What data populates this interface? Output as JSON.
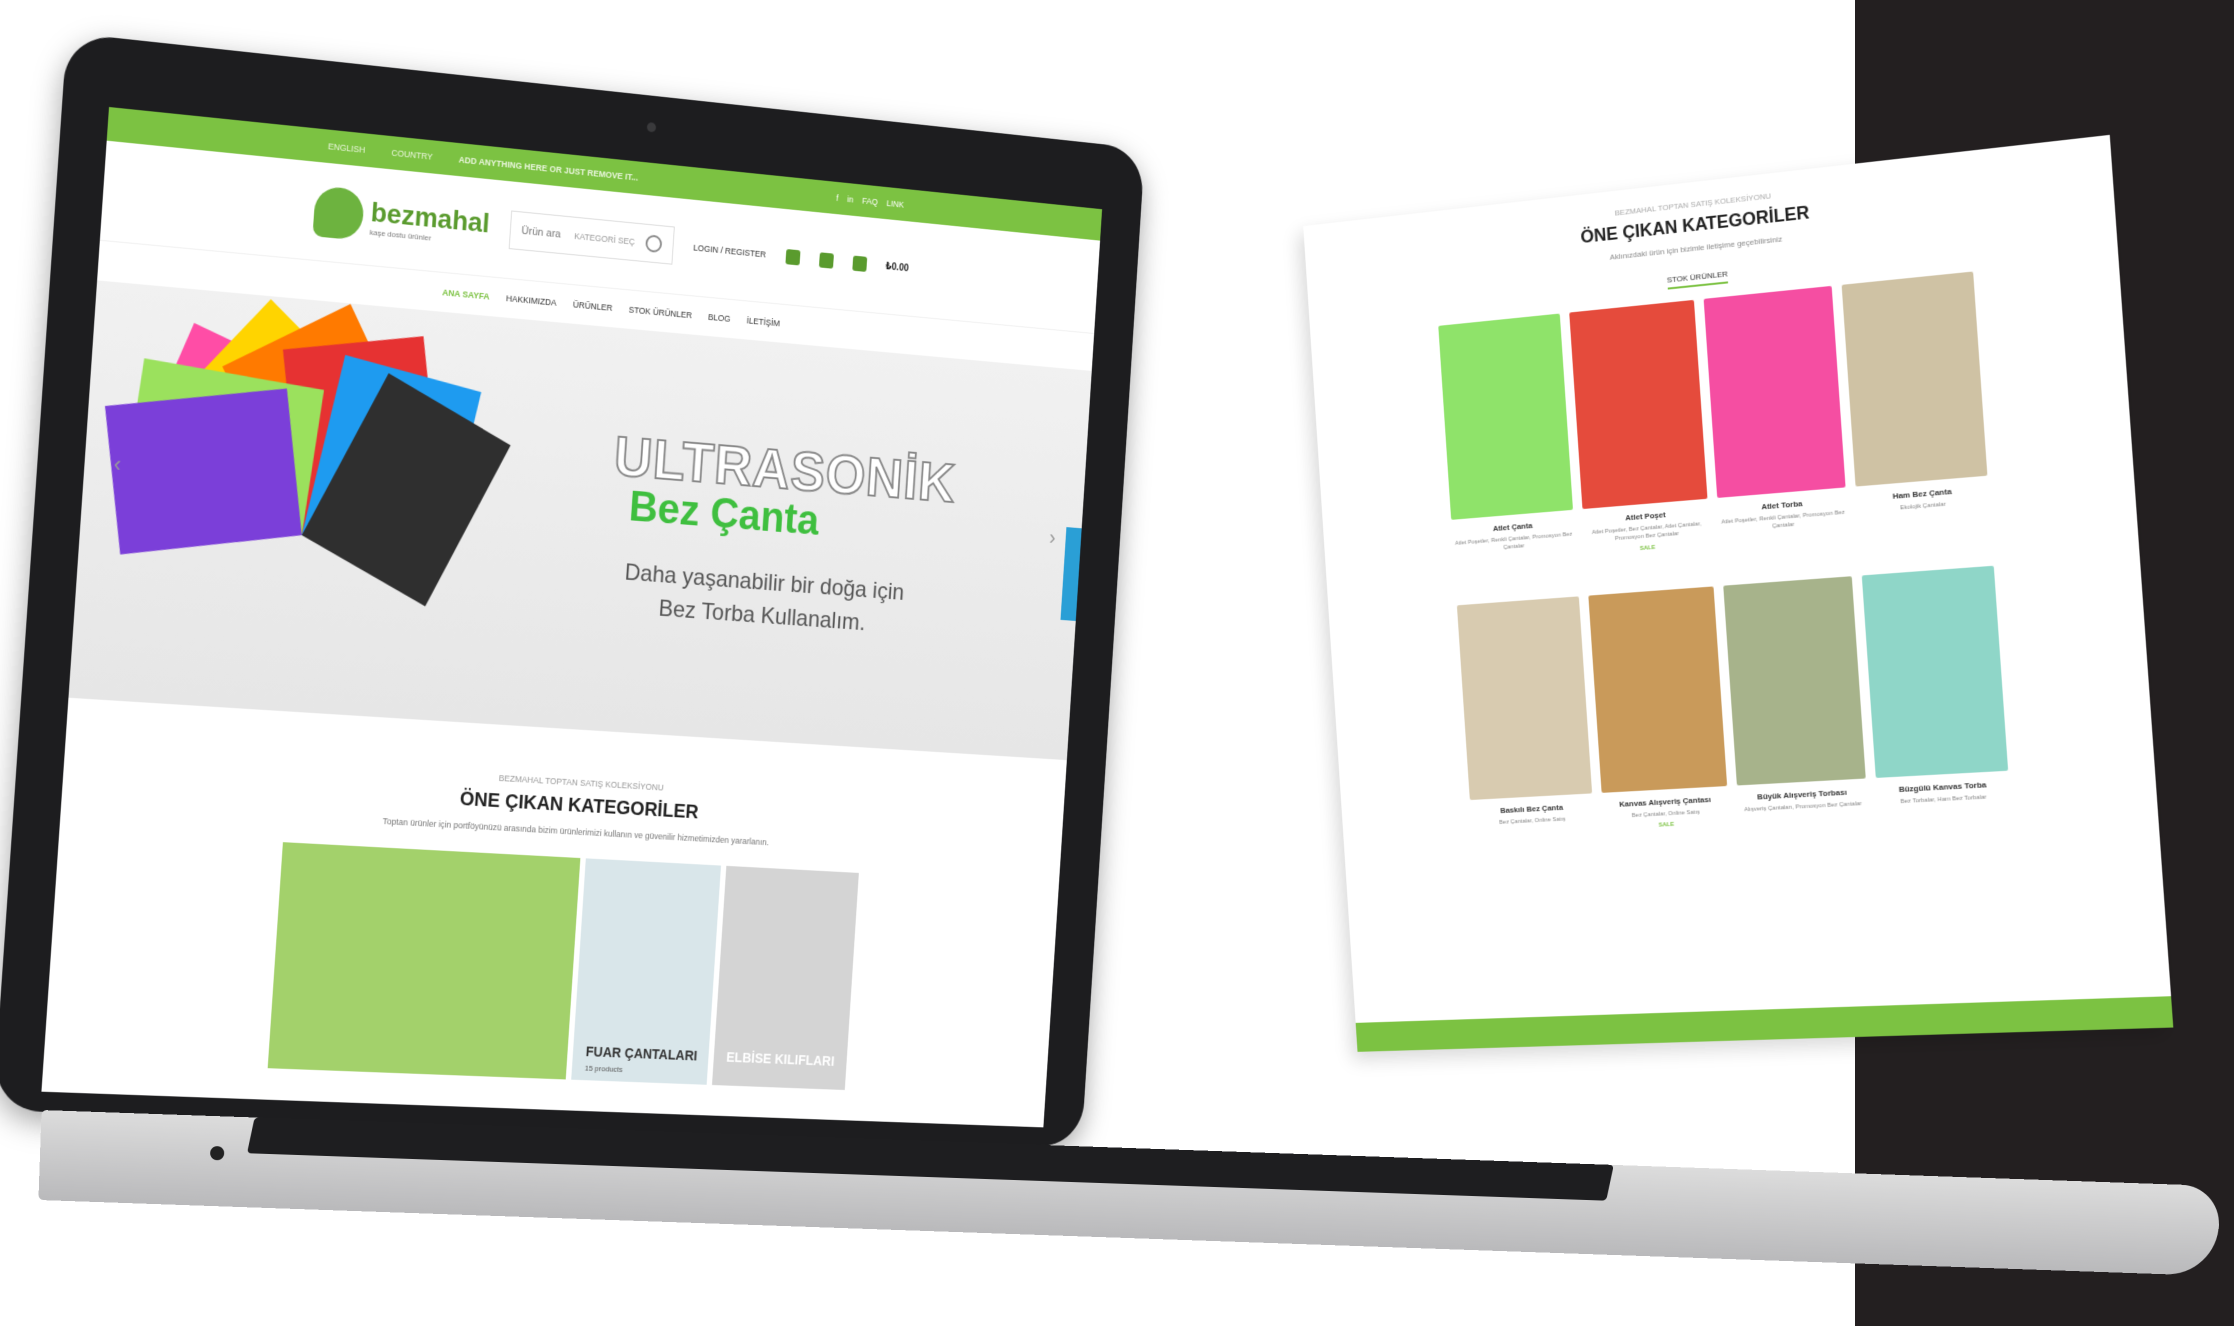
{
  "topbar": {
    "lang": "ENGLISH",
    "country": "COUNTRY",
    "promo": "ADD ANYTHING HERE OR JUST REMOVE IT...",
    "social_1": "f",
    "social_2": "in",
    "faq": "FAQ",
    "link": "LINK"
  },
  "header": {
    "logo_name": "bezmahal",
    "logo_tagline": "kaşe dostu ürünler",
    "search_placeholder": "Ürün ara",
    "search_category": "KATEGORİ SEÇ",
    "login_register": "LOGIN / REGISTER",
    "cart_price": "₺0.00"
  },
  "nav": {
    "items": [
      "ANA SAYFA",
      "HAKKIMIZDA",
      "ÜRÜNLER",
      "STOK ÜRÜNLER",
      "BLOG",
      "İLETİŞİM"
    ]
  },
  "hero": {
    "title": "ULTRASONİK",
    "subtitle": "Bez Çanta",
    "line1": "Daha yaşanabilir bir doğa için",
    "line2": "Bez Torba Kullanalım.",
    "arrow_prev": "‹",
    "arrow_next": "›"
  },
  "section": {
    "kicker": "BEZMAHAL TOPTAN SATIŞ KOLEKSİYONU",
    "title": "ÖNE ÇIKAN KATEGORİLER",
    "desc": "Toptan ürünler için portföyünüzü arasında bizim ürünlerimizi kullanın ve güvenilir hizmetimizden yararlanın."
  },
  "categories": [
    {
      "label": "",
      "sub": "",
      "color": "#a3d16b"
    },
    {
      "label": "FUAR ÇANTALARI",
      "sub": "15 products",
      "color": "#d9e6ea"
    },
    {
      "label": "ELBİSE KILIFLARI",
      "sub": "",
      "color": "#d4d4d4"
    }
  ],
  "page_card": {
    "kicker": "BEZMAHAL TOPTAN SATIŞ KOLEKSİYONU",
    "title": "ÖNE ÇIKAN KATEGORİLER",
    "desc": "Aklınızdaki ürün için bizimle iletişime geçebilirsiniz",
    "tab": "STOK ÜRÜNLER",
    "products": [
      {
        "name": "Atlet Çanta",
        "cats": "Atlet Poşetler, Renkli Çantalar, Promosyon Bez Çantalar",
        "badge": "",
        "color": "#8fe36a"
      },
      {
        "name": "Atlet Poşet",
        "cats": "Atlet Poşetler, Bez Çantalar, Atlet Çantalar, Promosyon Bez Çantalar",
        "badge": "SALE",
        "color": "#e54b3c"
      },
      {
        "name": "Atlet Torba",
        "cats": "Atlet Poşetler, Renkli Çantalar, Promosyon Bez Çantalar",
        "badge": "",
        "color": "#f54ea2"
      },
      {
        "name": "Ham Bez Çanta",
        "cats": "Ekolojik Çantalar",
        "badge": "",
        "color": "#cfc2a4"
      },
      {
        "name": "Baskılı Bez Çanta",
        "cats": "Bez Çantalar, Online Satış",
        "badge": "",
        "color": "#d8cbb0"
      },
      {
        "name": "Kanvas Alışveriş Çantası",
        "cats": "Bez Çantalar, Online Satış",
        "badge": "SALE",
        "color": "#c99a5a"
      },
      {
        "name": "Büyük Alışveriş Torbası",
        "cats": "Alışveriş Çantaları, Promosyon Bez Çantalar",
        "badge": "",
        "color": "#a7b38b"
      },
      {
        "name": "Büzgülü Kanvas Torba",
        "cats": "Bez Torbalar, Ham Bez Torbalar",
        "badge": "",
        "color": "#8fd6c8"
      }
    ]
  },
  "colors": {
    "brand_green": "#7cc242",
    "dark_panel": "#231f20"
  }
}
